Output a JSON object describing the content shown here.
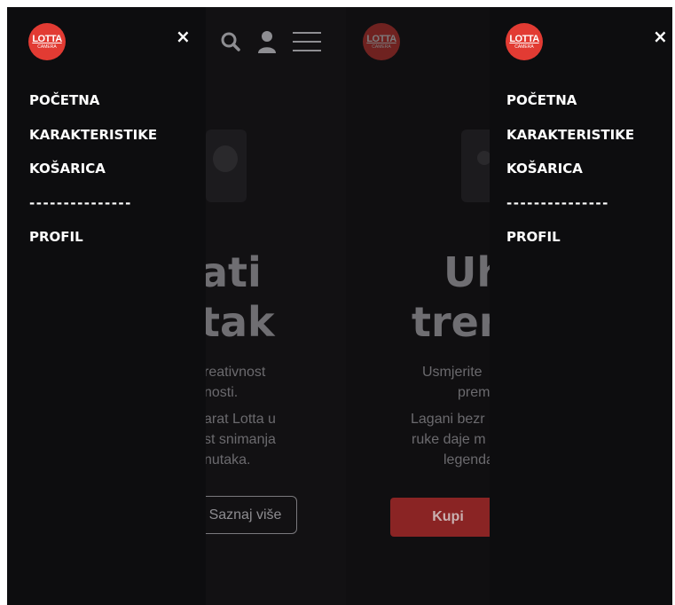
{
  "logo": {
    "text": "LOTTA",
    "sub": "CAMERA"
  },
  "menu": {
    "items": [
      "POČETNA",
      "KARAKTERISTIKE",
      "KOŠARICA"
    ],
    "divider": "---------------",
    "profile": "PROFIL",
    "close": "×"
  },
  "left_page": {
    "title_line1": "ati",
    "title_line2": "tak",
    "text1_line1": "reativnost",
    "text1_line2": "nosti.",
    "text2_line1": "arat Lotta u",
    "text2_line2": "st snimanja",
    "text2_line3": "nutaka.",
    "button": "Saznaj više"
  },
  "right_page": {
    "title_line1": "Uh",
    "title_line2": "tren",
    "text1_line1": "Usmjerite",
    "text1_line2": "prem.",
    "text2_line1": "Lagani bezr",
    "text2_line2": "ruke daje m",
    "text2_line3": "legenda",
    "button": "Kupi"
  },
  "colors": {
    "accent": "#e23b33",
    "buy_button": "#8a2424",
    "background": "#0f0e10"
  }
}
